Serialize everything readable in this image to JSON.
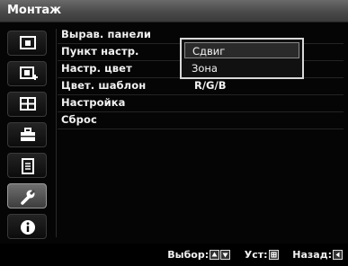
{
  "window": {
    "title": "Монтаж"
  },
  "sidebar": {
    "icons": [
      {
        "name": "picture-icon"
      },
      {
        "name": "picture-plus-icon"
      },
      {
        "name": "screen-grid-icon"
      },
      {
        "name": "toolbox-icon"
      },
      {
        "name": "list-icon"
      },
      {
        "name": "wrench-icon",
        "active": true
      },
      {
        "name": "info-icon"
      }
    ]
  },
  "menu": {
    "items": [
      {
        "label": "Вырав. панели",
        "value": ""
      },
      {
        "label": "Пункт настр.",
        "value": ""
      },
      {
        "label": "Настр. цвет",
        "value": ""
      },
      {
        "label": "Цвет. шаблон",
        "value": "R/G/B"
      },
      {
        "label": "Настройка",
        "value": ""
      },
      {
        "label": "Сброс",
        "value": ""
      }
    ]
  },
  "dropdown": {
    "options": [
      {
        "label": "Сдвиг",
        "selected": true
      },
      {
        "label": "Зона",
        "selected": false
      }
    ]
  },
  "footer": {
    "select_label": "Выбор:",
    "set_label": "Уст:",
    "back_label": "Назад:"
  }
}
